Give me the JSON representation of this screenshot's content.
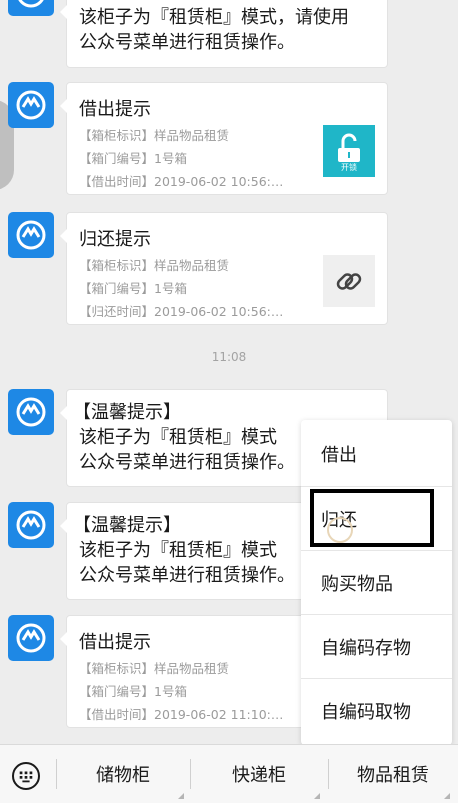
{
  "messages": [
    {
      "kind": "text",
      "lines": [
        "该柜子为『租赁柜』模式，请使用",
        "公众号菜单进行租赁操作。"
      ]
    },
    {
      "kind": "card",
      "title": "借出提示",
      "lines": [
        "【箱柜标识】样品物品租赁",
        "【箱门编号】1号箱",
        "【借出时间】2019-06-02 10:56:…"
      ],
      "thumb_label": "开锁",
      "thumb_icon": "unlock-icon",
      "thumb_color": "#1fb6c8"
    },
    {
      "kind": "card",
      "title": "归还提示",
      "lines": [
        "【箱柜标识】样品物品租赁",
        "【箱门编号】1号箱",
        "【归还时间】2019-06-02 10:56:…"
      ],
      "thumb_icon": "link-icon",
      "thumb_color": "#efefef"
    },
    {
      "kind": "text",
      "lines": [
        "【温馨提示】",
        "该柜子为『租赁柜』模式",
        "公众号菜单进行租赁操作。"
      ]
    },
    {
      "kind": "text",
      "lines": [
        "【温馨提示】",
        "该柜子为『租赁柜』模式",
        "公众号菜单进行租赁操作。"
      ]
    },
    {
      "kind": "card",
      "title": "借出提示",
      "lines": [
        "【箱柜标识】样品物品租赁",
        "【箱门编号】1号箱",
        "【借出时间】2019-06-02 11:10:…"
      ]
    }
  ],
  "timestamp": "11:08",
  "popup_menu": {
    "items": [
      "借出",
      "归还",
      "购买物品",
      "自编码存物",
      "自编码取物"
    ],
    "highlighted": "归还"
  },
  "bottom_menu": {
    "tabs": [
      "储物柜",
      "快递柜",
      "物品租赁"
    ]
  },
  "colors": {
    "avatar": "#1e88e5",
    "background": "#ededed"
  }
}
